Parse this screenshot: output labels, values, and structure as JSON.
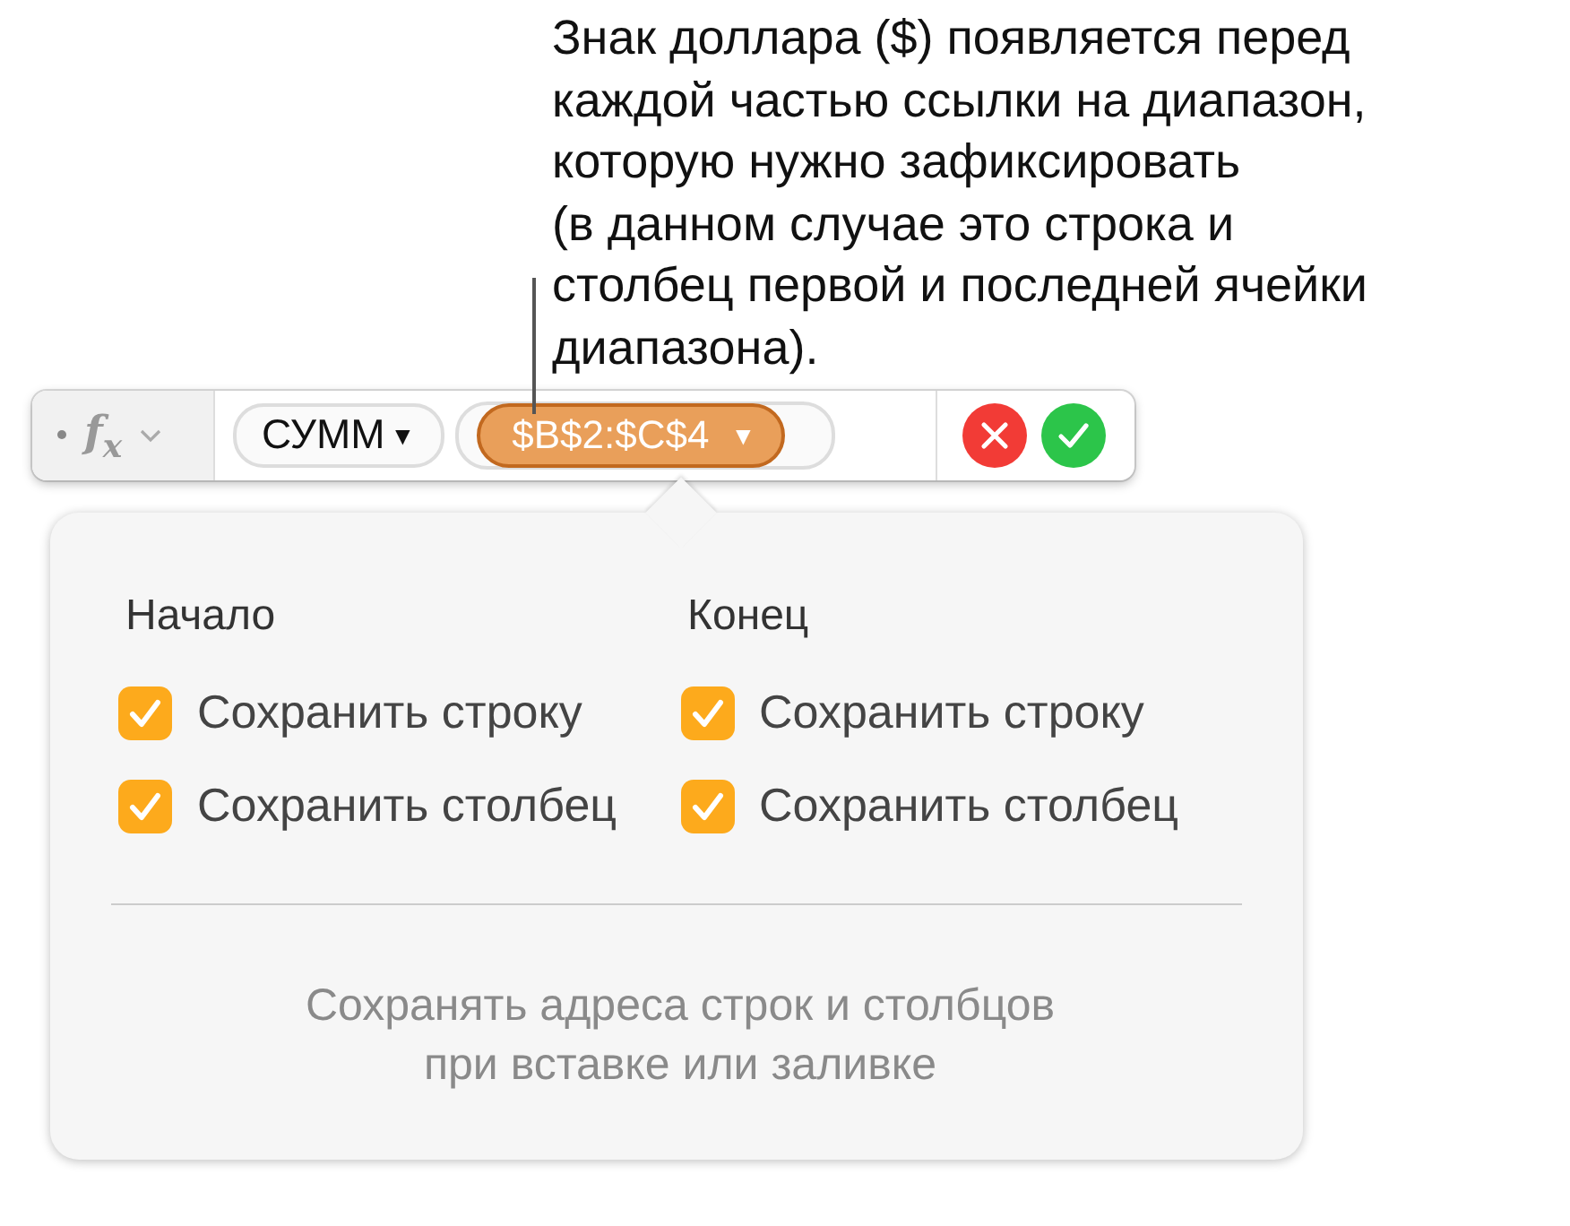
{
  "callout": {
    "lines": [
      "Знак доллара ($) появляется перед",
      "каждой частью ссылки на диапазон,",
      "которую нужно зафиксировать",
      "(в данном случае это строка и",
      "столбец первой и последней ячейки",
      "диапазона)."
    ]
  },
  "formula_bar": {
    "fx_label": "f$_{x}$",
    "function": "СУММ",
    "function_caret": "▼",
    "range": "$B$2:$C$4",
    "range_caret": "▼"
  },
  "popover": {
    "columns": [
      {
        "title": "Начало",
        "options": [
          {
            "label": "Сохранить строку",
            "checked": true
          },
          {
            "label": "Сохранить столбец",
            "checked": true
          }
        ]
      },
      {
        "title": "Конец",
        "options": [
          {
            "label": "Сохранить строку",
            "checked": true
          },
          {
            "label": "Сохранить столбец",
            "checked": true
          }
        ]
      }
    ],
    "footer": [
      "Сохранять адреса строк и столбцов",
      "при вставке или заливке"
    ]
  }
}
